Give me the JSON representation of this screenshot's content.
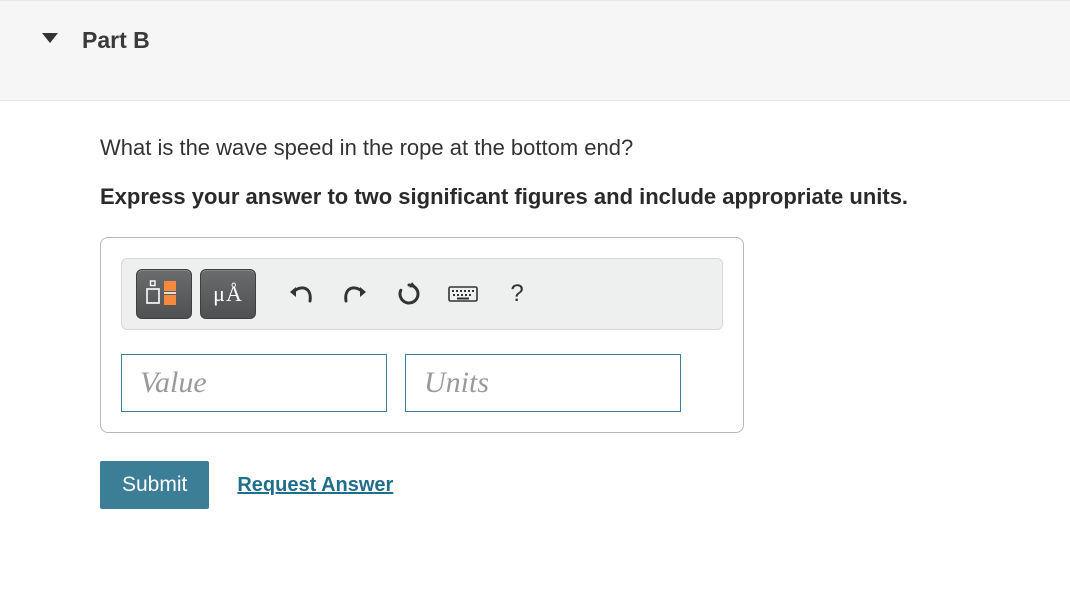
{
  "header": {
    "part_label": "Part B"
  },
  "question": "What is the wave speed in the rope at the bottom end?",
  "instruction": "Express your answer to two significant figures and include appropriate units.",
  "toolbar": {
    "templates_icon": "templates-icon",
    "symbols_label": "μÅ",
    "undo_icon": "undo-icon",
    "redo_icon": "redo-icon",
    "reset_icon": "reset-icon",
    "keyboard_icon": "keyboard-icon",
    "help_label": "?"
  },
  "inputs": {
    "value_placeholder": "Value",
    "value": "",
    "units_placeholder": "Units",
    "units": ""
  },
  "actions": {
    "submit_label": "Submit",
    "request_answer_label": "Request Answer"
  }
}
